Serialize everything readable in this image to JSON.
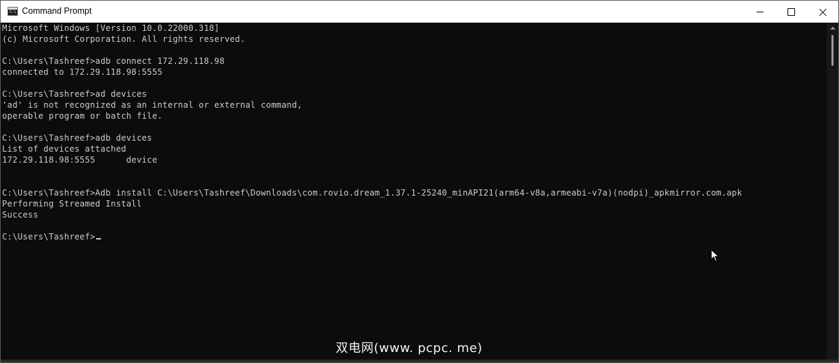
{
  "window": {
    "title": "Command Prompt",
    "icon_text": "C:\\"
  },
  "console": {
    "lines": [
      "Microsoft Windows [Version 10.0.22000.318]",
      "(c) Microsoft Corporation. All rights reserved.",
      "",
      "C:\\Users\\Tashreef>adb connect 172.29.118.98",
      "connected to 172.29.118.98:5555",
      "",
      "C:\\Users\\Tashreef>ad devices",
      "'ad' is not recognized as an internal or external command,",
      "operable program or batch file.",
      "",
      "C:\\Users\\Tashreef>adb devices",
      "List of devices attached",
      "172.29.118.98:5555      device",
      "",
      "",
      "C:\\Users\\Tashreef>Adb install C:\\Users\\Tashreef\\Downloads\\com.rovio.dream_1.37.1-25240_minAPI21(arm64-v8a,armeabi-v7a)(nodpi)_apkmirror.com.apk",
      "Performing Streamed Install",
      "Success",
      "",
      "C:\\Users\\Tashreef>"
    ]
  },
  "watermark": "双电网(www. pcpc. me)",
  "icons": {
    "app": "command-prompt-icon",
    "minimize": "minimize-icon",
    "maximize": "maximize-icon",
    "close": "close-icon",
    "pointer": "mouse-pointer-icon"
  },
  "colors": {
    "console_bg": "#0c0c0c",
    "console_text": "#cccccc",
    "titlebar_bg": "#ffffff"
  }
}
